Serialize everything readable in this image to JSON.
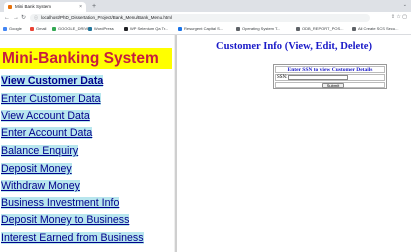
{
  "browser": {
    "tab_title": "Mini Bank System",
    "tab_close": "×",
    "new_tab": "+",
    "window_controls": "⌄",
    "url": "localhost/PhD_Dissertation_Project/Bank_Menu/Bank_Menu.html",
    "bookmarks": [
      {
        "label": "Google",
        "color": "#4285f4"
      },
      {
        "label": "Gmail",
        "color": "#ea4335"
      },
      {
        "label": "GOOGLE_DRIVE",
        "color": "#34a853"
      },
      {
        "label": "WordPress",
        "color": "#21759b"
      },
      {
        "label": "WP Selenium Qa Tr...",
        "color": "#202124"
      },
      {
        "label": "Resurgent Capital S...",
        "color": "#1a73e8"
      },
      {
        "label": "Operating System T...",
        "color": "#5f6368"
      },
      {
        "label": "ODB_REPORT_POS...",
        "color": "#5f6368"
      },
      {
        "label": "All Create SCS Secu...",
        "color": "#5f6368"
      }
    ]
  },
  "left_frame": {
    "title": "Mini-Banking System",
    "menu": [
      "View Customer Data",
      "Enter Customer Data",
      "View Account Data",
      "Enter Account Data",
      "Balance Enquiry",
      "Deposit Money",
      "Withdraw Money",
      "Business Investment Info",
      "Deposit Money to Business",
      "Interest Earned from Business"
    ]
  },
  "right_frame": {
    "title": "Customer Info (View, Edit, Delete)",
    "form_caption": "Enter SSN to view Customer Details",
    "ssn_label": "SSN:",
    "ssn_value": "",
    "submit_label": "Submit"
  },
  "colors": {
    "title_bg": "#ffff00",
    "title_text": "#c71c3f",
    "menu_bg": "#b8e6ee",
    "menu_text": "#00008b",
    "heading_text": "#1a1ac8"
  }
}
